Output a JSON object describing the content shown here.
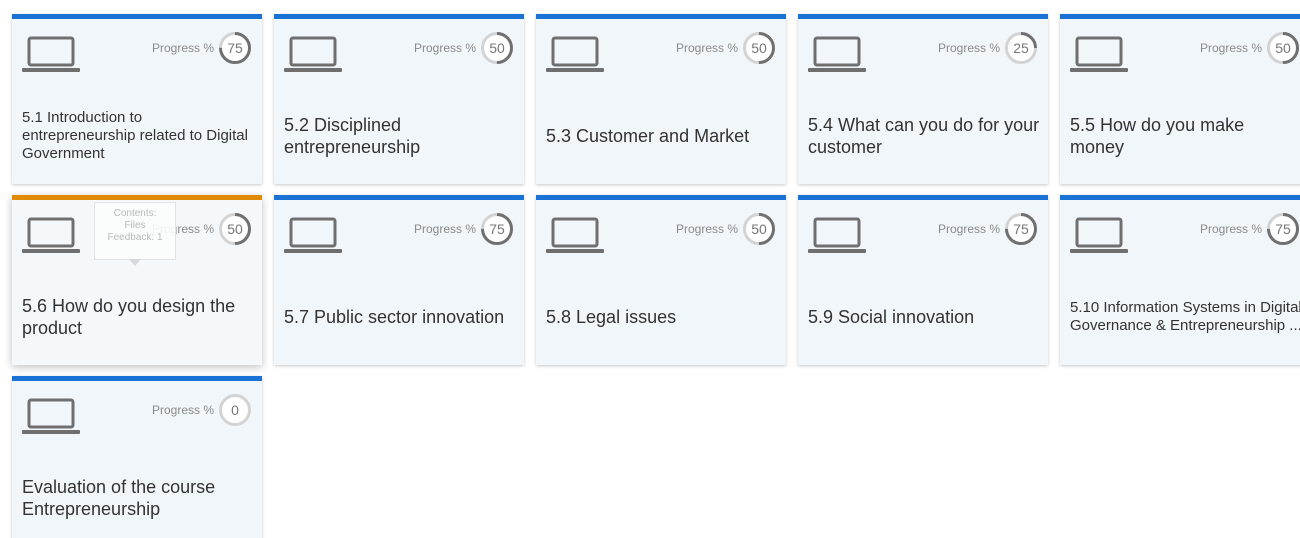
{
  "progress_label": "Progress %",
  "tooltip": {
    "contents": "Contents:",
    "files": "Files",
    "feedback": "Feedback: 1"
  },
  "colors": {
    "accent_blue": "#1a73d4",
    "accent_orange": "#e08a00",
    "ring_track": "#d3d3d3",
    "ring_fill": "#707070"
  },
  "icon": "laptop-icon",
  "tiles": [
    {
      "title": "5.1 Introduction to entrepreneurship related to Digital Government",
      "progress": 75
    },
    {
      "title": "5.2 Disciplined entrepreneurship",
      "progress": 50
    },
    {
      "title": "5.3 Customer and Market",
      "progress": 50
    },
    {
      "title": "5.4 What can you do for your customer",
      "progress": 25
    },
    {
      "title": "5.5 How do you make money",
      "progress": 50
    },
    {
      "title": "5.6 How do you design the product",
      "progress": 50,
      "active": true
    },
    {
      "title": "5.7 Public sector innovation",
      "progress": 75
    },
    {
      "title": "5.8 Legal issues",
      "progress": 50
    },
    {
      "title": "5.9 Social innovation",
      "progress": 75
    },
    {
      "title": "5.10 Information Systems in Digital Governance & Entrepreneurship ...",
      "progress": 75
    },
    {
      "title": "Evaluation of the course Entrepreneurship",
      "progress": 0
    }
  ]
}
